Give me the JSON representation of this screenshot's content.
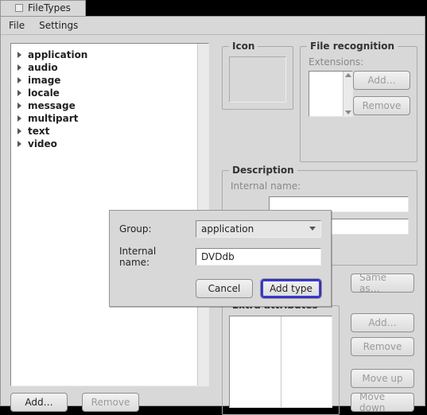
{
  "window": {
    "title": "FileTypes"
  },
  "menu": {
    "file": "File",
    "settings": "Settings"
  },
  "tree": {
    "items": [
      {
        "label": "application"
      },
      {
        "label": "audio"
      },
      {
        "label": "image"
      },
      {
        "label": "locale"
      },
      {
        "label": "message"
      },
      {
        "label": "multipart"
      },
      {
        "label": "text"
      },
      {
        "label": "video"
      }
    ],
    "add": "Add…",
    "remove": "Remove"
  },
  "icon": {
    "legend": "Icon"
  },
  "filerec": {
    "legend": "File recognition",
    "extensions_label": "Extensions:",
    "add": "Add…",
    "remove": "Remove"
  },
  "description": {
    "legend": "Description",
    "internal_label": "Internal name:"
  },
  "sameas": "Same as…",
  "extra": {
    "legend": "Extra attributes",
    "add": "Add…",
    "remove": "Remove",
    "moveup": "Move up",
    "movedown": "Move down"
  },
  "dialog": {
    "group_label": "Group:",
    "group_value": "application",
    "internal_label": "Internal name:",
    "internal_value": "DVDdb",
    "cancel": "Cancel",
    "addtype": "Add type"
  }
}
